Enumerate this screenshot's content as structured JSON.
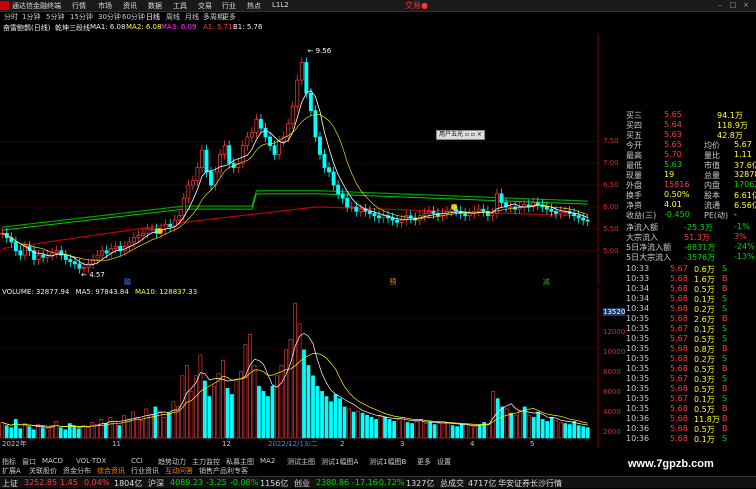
{
  "menubar": {
    "app_title": "通达信金融终端",
    "items": [
      "行情",
      "市场",
      "资讯",
      "数据",
      "工具",
      "交易",
      "行业",
      "热点",
      "L1L2"
    ],
    "brand": "交易●"
  },
  "periods": [
    "分时",
    "1分钟",
    "5分钟",
    "15分钟",
    "30分钟",
    "60分钟",
    "日线",
    "周线",
    "月线",
    "多周期",
    "更多"
  ],
  "active_period": "日线",
  "indicator_row": {
    "name": "奋雷鲍鹊(日线)",
    "main": "乾坤三段线",
    "ma1": "MA1: 6.08",
    "ma2": "MA2: 6.08",
    "ma3": "MA3: 6.09",
    "a1": "A1: 5.71",
    "b1": "B1: 5.76"
  },
  "kline": {
    "high_label": "9.56",
    "low_label": "4.57",
    "axis": [
      "7.50",
      "7.00",
      "6.50",
      "6.00",
      "5.50",
      "5.00"
    ],
    "markers": [
      {
        "text": "融",
        "color": "#4488ff"
      },
      {
        "text": "预",
        "color": "#ff8800"
      },
      {
        "text": "减",
        "color": "#00cc00"
      }
    ],
    "closes": [
      5.4,
      5.3,
      5.2,
      5.0,
      4.9,
      5.1,
      5.0,
      4.8,
      4.9,
      4.85,
      4.9,
      4.95,
      5.0,
      4.9,
      4.8,
      4.75,
      4.7,
      4.6,
      4.62,
      4.7,
      4.8,
      4.9,
      5.0,
      4.95,
      5.05,
      5.1,
      5.0,
      5.1,
      5.2,
      5.3,
      5.35,
      5.4,
      5.5,
      5.5,
      5.4,
      5.5,
      5.6,
      5.55,
      5.7,
      5.8,
      6.2,
      6.5,
      6.6,
      6.9,
      7.3,
      6.8,
      6.5,
      6.8,
      7.2,
      7.4,
      7.0,
      6.9,
      7.0,
      7.4,
      7.6,
      7.7,
      8.0,
      7.8,
      7.6,
      7.4,
      7.2,
      7.5,
      7.6,
      7.9,
      8.3,
      8.9,
      9.3,
      8.6,
      8.2,
      7.6,
      7.2,
      6.9,
      6.8,
      6.5,
      6.3,
      6.2,
      6.0,
      6.0,
      5.9,
      5.95,
      5.9,
      5.85,
      5.8,
      5.75,
      5.8,
      5.75,
      5.7,
      5.65,
      5.7,
      5.8,
      5.75,
      5.7,
      5.8,
      5.85,
      5.9,
      5.85,
      5.8,
      5.85,
      5.9,
      5.95,
      5.9,
      5.85,
      5.8,
      5.85,
      5.9,
      5.95,
      5.9,
      5.8,
      5.85,
      6.3,
      6.1,
      6.0,
      6.0,
      5.95,
      6.0,
      6.05,
      6.0,
      6.1,
      6.05,
      6.0,
      5.95,
      5.9,
      5.85,
      5.9,
      5.9,
      5.85,
      5.8,
      5.75,
      5.7,
      5.68
    ]
  },
  "volume": {
    "title": "VOLUME: 32877.94",
    "ma5": "MA5: 97843.84",
    "ma10": "MA10: 128837.33",
    "axis": [
      "13520",
      "12000",
      "10000",
      "8000",
      "6000",
      "4000",
      "2000"
    ],
    "values": [
      15,
      12,
      10,
      18,
      9,
      14,
      11,
      8,
      13,
      10,
      9,
      12,
      16,
      10,
      8,
      14,
      11,
      9,
      12,
      10,
      15,
      13,
      18,
      14,
      20,
      16,
      12,
      22,
      18,
      25,
      20,
      17,
      28,
      22,
      30,
      26,
      20,
      24,
      35,
      30,
      60,
      70,
      45,
      60,
      80,
      55,
      40,
      50,
      62,
      75,
      48,
      42,
      55,
      64,
      90,
      100,
      70,
      50,
      45,
      40,
      50,
      60,
      70,
      85,
      95,
      130,
      110,
      85,
      70,
      60,
      50,
      45,
      40,
      35,
      42,
      38,
      30,
      28,
      25,
      26,
      24,
      22,
      20,
      18,
      22,
      20,
      18,
      16,
      18,
      20,
      15,
      14,
      16,
      18,
      14,
      15,
      13,
      14,
      16,
      15,
      12,
      11,
      13,
      14,
      12,
      11,
      12,
      15,
      14,
      45,
      38,
      30,
      28,
      24,
      22,
      26,
      30,
      22,
      20,
      25,
      18,
      16,
      20,
      17,
      15,
      14,
      13,
      16,
      12,
      11,
      10
    ],
    "date_labels": [
      "2022年",
      "11",
      "12",
      "2022/12/13/二",
      "2",
      "3",
      "4",
      "5"
    ]
  },
  "stock_panel": {
    "rows": [
      {
        "l": "买三",
        "v": "5.65",
        "c": "94.1万",
        "vcolor": "#ff3b3b"
      },
      {
        "l": "买四",
        "v": "5.64",
        "c": "118.9万",
        "vcolor": "#ff3b3b"
      },
      {
        "l": "买五",
        "v": "5.63",
        "c": "42.8万",
        "vcolor": "#ff3b3b"
      },
      {
        "l": "今开",
        "v": "5.65",
        "c2": "均价",
        "v2": "5.67"
      },
      {
        "l": "最高",
        "v": "5.70",
        "c2": "量比",
        "v2": "1.11"
      },
      {
        "l": "最低",
        "v": "5.63",
        "c2": "市值",
        "v2": "37.6亿"
      },
      {
        "l": "现量",
        "v": "19",
        "c2": "总量",
        "v2": "32878"
      },
      {
        "l": "外盘",
        "v": "15816",
        "c2": "内盘",
        "v2": "17062"
      },
      {
        "l": "换手",
        "v": "0.50%",
        "c2": "股本",
        "v2": "6.61亿"
      },
      {
        "l": "净资",
        "v": "4.01",
        "c2": "流通",
        "v2": "6.56亿"
      },
      {
        "l": "收益(三)",
        "v": "-0.450",
        "c2": "PE(动)",
        "v2": "-"
      }
    ],
    "flows": [
      {
        "l": "净流入额",
        "v": "-25.3万",
        "p": "-1%"
      },
      {
        "l": "大宗流入",
        "v": "51.3万",
        "p": "3%"
      },
      {
        "l": "5日净流入额",
        "v": "-6831万",
        "p": "-24%"
      },
      {
        "l": "5日大宗流入",
        "v": "-3576万",
        "p": "-13%"
      }
    ],
    "ticks": [
      {
        "t": "10:33",
        "p": "5.67",
        "v": "0.6万",
        "d": "S"
      },
      {
        "t": "10:33",
        "p": "5.68",
        "v": "1.6万",
        "d": "B"
      },
      {
        "t": "10:34",
        "p": "5.68",
        "v": "0.5万",
        "d": "B"
      },
      {
        "t": "10:34",
        "p": "5.68",
        "v": "0.1万",
        "d": "S"
      },
      {
        "t": "10:34",
        "p": "5.68",
        "v": "0.2万",
        "d": "S"
      },
      {
        "t": "10:35",
        "p": "5.68",
        "v": "2.6万",
        "d": "B"
      },
      {
        "t": "10:35",
        "p": "5.67",
        "v": "0.1万",
        "d": "S"
      },
      {
        "t": "10:35",
        "p": "5.67",
        "v": "0.5万",
        "d": "S"
      },
      {
        "t": "10:35",
        "p": "5.68",
        "v": "0.8万",
        "d": "B"
      },
      {
        "t": "10:35",
        "p": "5.68",
        "v": "0.2万",
        "d": "S"
      },
      {
        "t": "10:35",
        "p": "5.68",
        "v": "0.5万",
        "d": "B"
      },
      {
        "t": "10:35",
        "p": "5.67",
        "v": "0.3万",
        "d": "S"
      },
      {
        "t": "10:35",
        "p": "5.68",
        "v": "0.5万",
        "d": "B"
      },
      {
        "t": "10:35",
        "p": "5.67",
        "v": "0.1万",
        "d": "S"
      },
      {
        "t": "10:35",
        "p": "5.68",
        "v": "0.5万",
        "d": "B"
      },
      {
        "t": "10:36",
        "p": "5.68",
        "v": "11.8万",
        "d": "B"
      },
      {
        "t": "10:36",
        "p": "5.68",
        "v": "0.5万",
        "d": "B"
      },
      {
        "t": "10:36",
        "p": "5.68",
        "v": "0.1万",
        "d": "S"
      }
    ],
    "popup": "用户五光"
  },
  "tabs": [
    "指标",
    "窗口",
    "MACD",
    "VOL-TDX",
    "CCI",
    "趋势动力",
    "主力监控",
    "私募主图",
    "MA2",
    "测试主图",
    "测试1幅图A",
    "测试1幅图B",
    "更多",
    "设置"
  ],
  "tabs2": [
    "扩展A",
    "关联股价",
    "资金分布",
    "综合资讯",
    "行业资讯",
    "互动问答",
    "销售产品利专客"
  ],
  "status": {
    "items": [
      {
        "n": "上证",
        "v": "3252.85",
        "c": "1.45",
        "p": "0.04%",
        "a": "1804亿"
      },
      {
        "n": "沪深",
        "v": "4089.23",
        "c": "-3.25",
        "p": "-0.08%",
        "a": "1156亿"
      },
      {
        "n": "创业",
        "v": "2380.86",
        "c": "-17.16",
        "p": "-0.72%",
        "a": "1327亿"
      }
    ],
    "total_label": "总成交",
    "total": "4717亿",
    "broker": "华安证券长沙行情"
  },
  "watermark": "www.7gpzb.com"
}
